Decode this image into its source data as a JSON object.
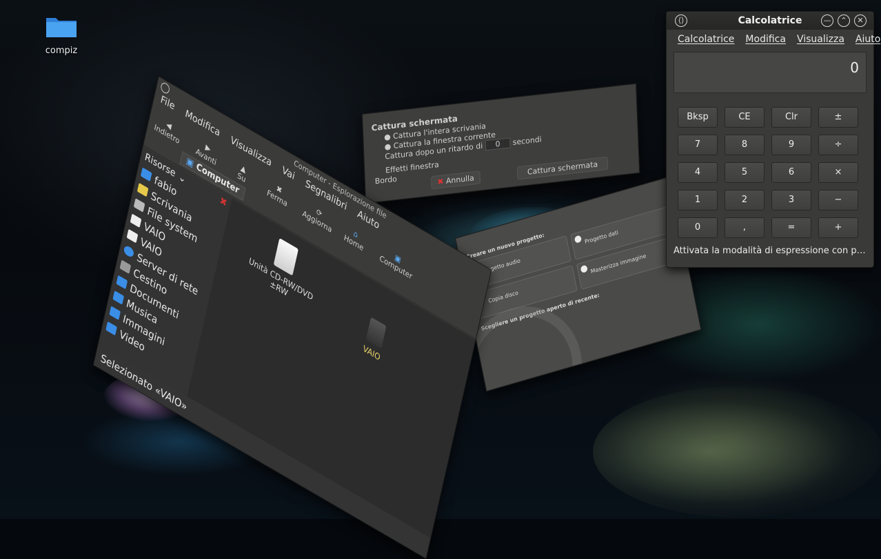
{
  "desktop": {
    "icons": [
      {
        "label": "compiz"
      }
    ]
  },
  "file_manager": {
    "menu": [
      "File",
      "Modifica",
      "Visualizza",
      "Vai",
      "Segnalibri",
      "Aiuto"
    ],
    "toolbar": [
      "Indietro",
      "Avanti",
      "Su",
      "Ferma",
      "Aggiorna",
      "Home",
      "Computer"
    ],
    "location": "Computer",
    "title": "Computer - Esplorazione file",
    "sidebar_header": "Risorse",
    "sidebar_items": [
      "fabio",
      "Scrivania",
      "File system",
      "VAIO",
      "VAIO",
      "Server di rete",
      "Cestino",
      "Documenti",
      "Musica",
      "Immagini",
      "Video"
    ],
    "items": [
      {
        "label": "Unità CD-RW/DVD ±RW"
      },
      {
        "label": "VAIO"
      }
    ],
    "status": "Selezionato «VAIO»"
  },
  "screenshot_dialog": {
    "heading": "Cattura schermata",
    "options": [
      "Cattura l'intera scrivania",
      "Cattura la finestra corrente",
      "Cattura dopo un ritardo di"
    ],
    "delay_value": "0",
    "delay_unit": "secondi",
    "effects_label": "Effetti finestra",
    "bordo": "Bordo",
    "cancel_label": "Annulla",
    "capture_label": "Cattura schermata"
  },
  "project_window": {
    "heading": "Creare un nuovo progetto:",
    "cards": [
      "Progetto audio",
      "Progetto dati",
      "Copia disco",
      "Masterizza immagine"
    ],
    "footer": "Scegliere un progetto aperto di recente:"
  },
  "calculator": {
    "title": "Calcolatrice",
    "menu": [
      "Calcolatrice",
      "Modifica",
      "Visualizza",
      "Aiuto"
    ],
    "display": "0",
    "keys": [
      "Bksp",
      "CE",
      "Clr",
      "±",
      "7",
      "8",
      "9",
      "÷",
      "4",
      "5",
      "6",
      "×",
      "1",
      "2",
      "3",
      "−",
      "0",
      ",",
      "=",
      "+"
    ],
    "status": "Attivata la modalità di espressione con pr..."
  }
}
